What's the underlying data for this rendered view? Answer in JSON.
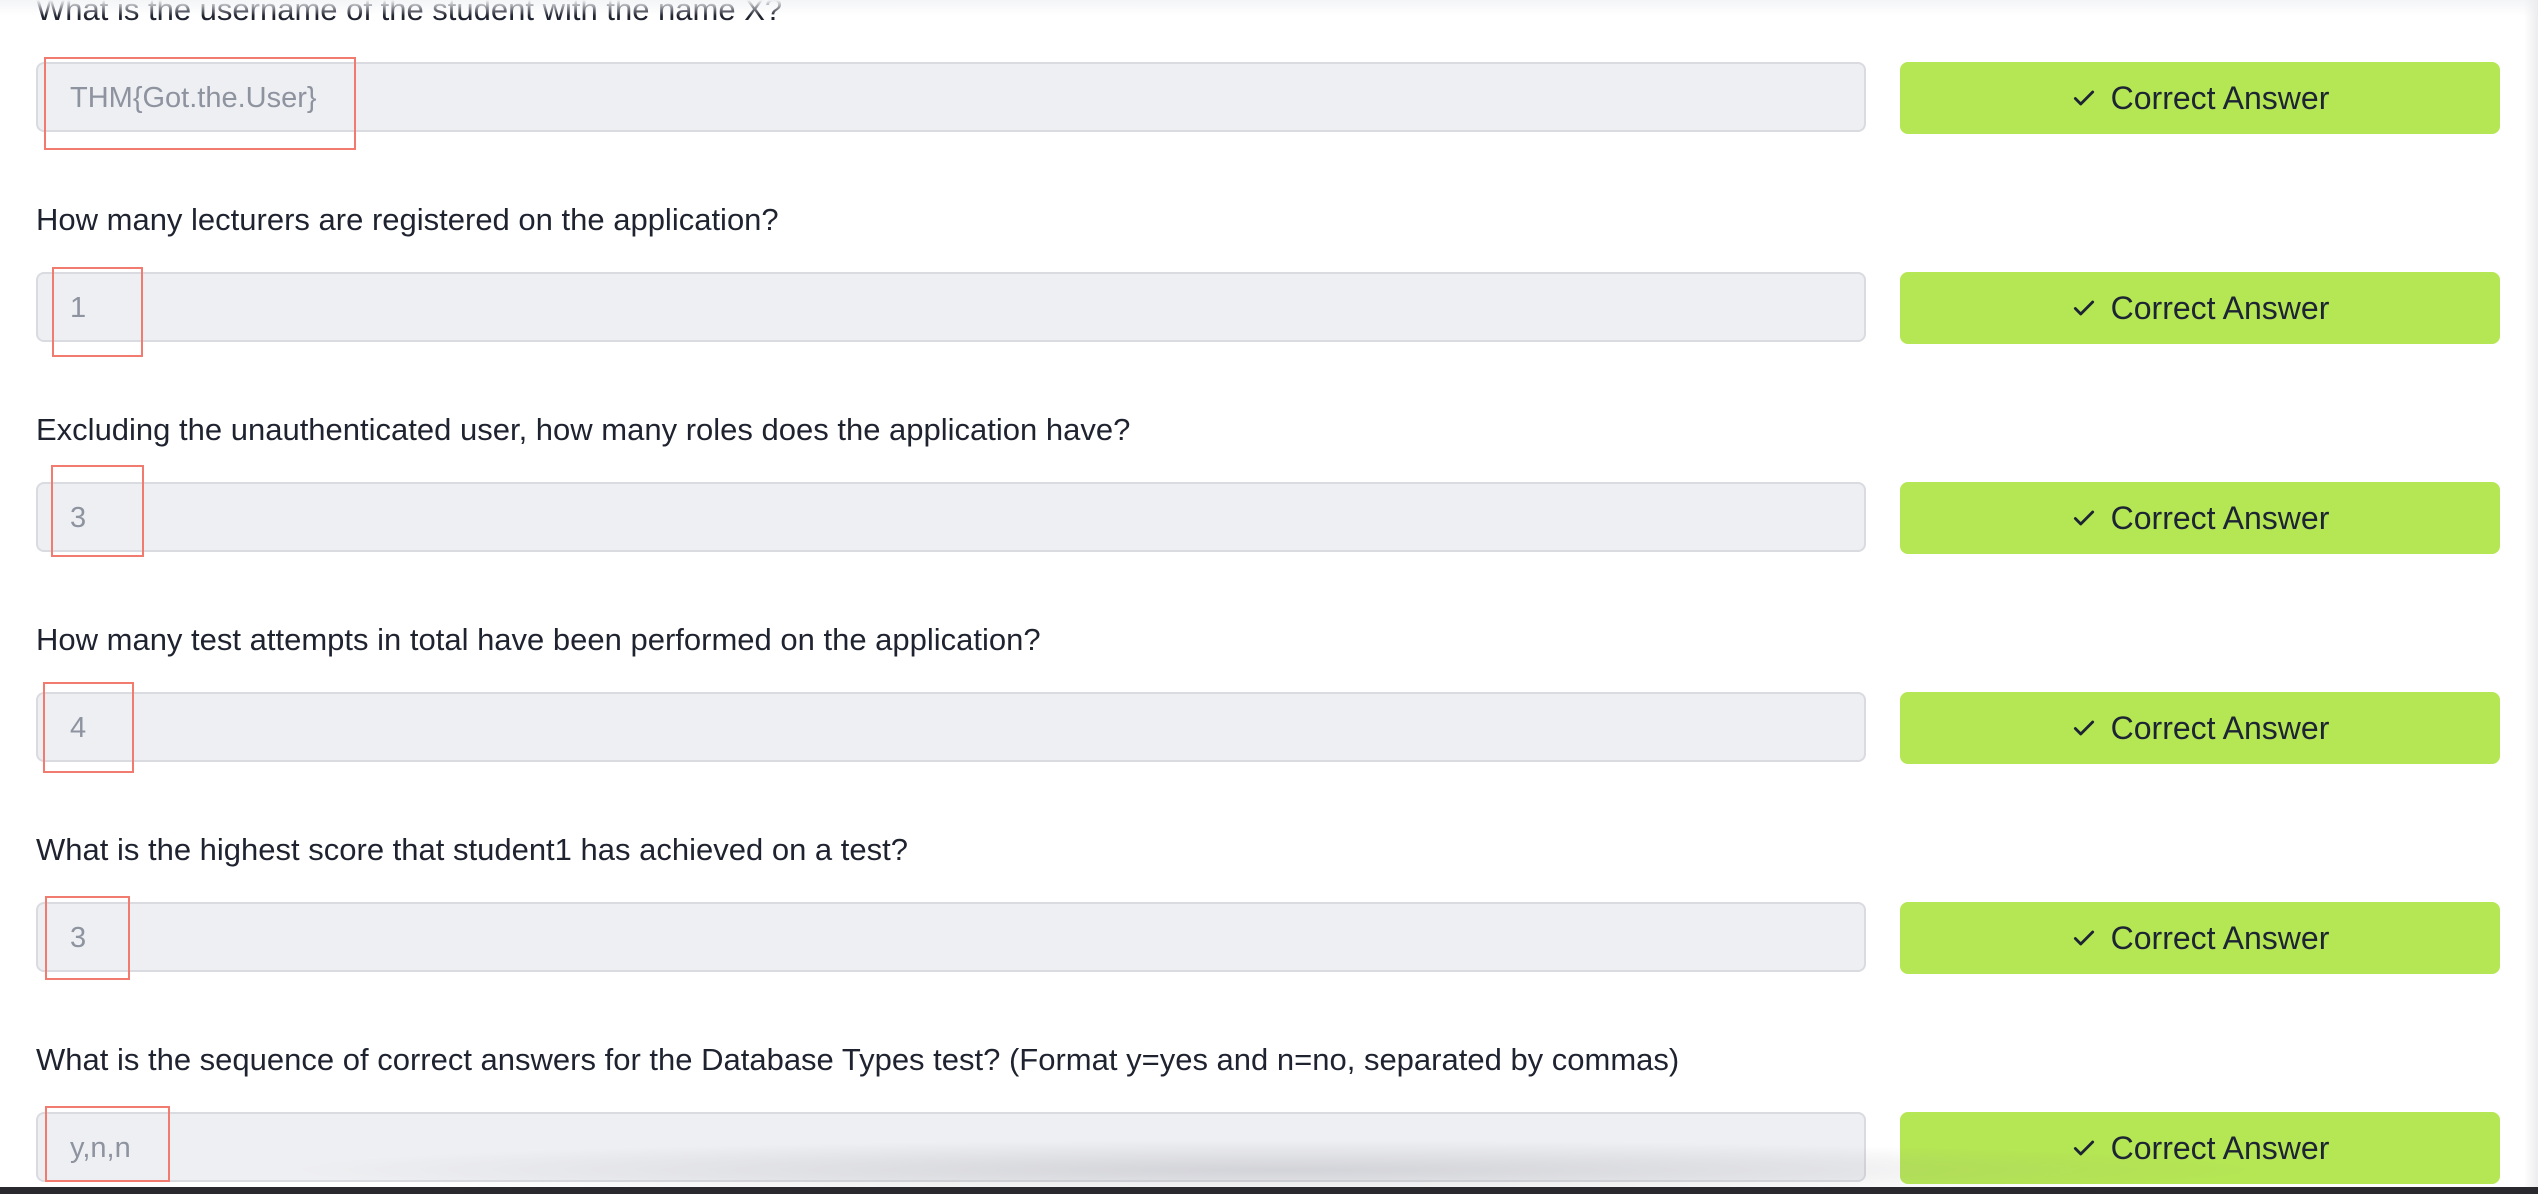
{
  "questions": [
    {
      "text": "What is the username of the student with the name X?",
      "answer": "THM{Got.the.User}",
      "button_label": "Correct Answer"
    },
    {
      "text": "How many lecturers are registered on the application?",
      "answer": "1",
      "button_label": "Correct Answer"
    },
    {
      "text": "Excluding the unauthenticated user, how many roles does the application have?",
      "answer": "3",
      "button_label": "Correct Answer"
    },
    {
      "text": "How many test attempts in total have been performed on the application?",
      "answer": "4",
      "button_label": "Correct Answer"
    },
    {
      "text": "What is the highest score that student1 has achieved on a test?",
      "answer": "3",
      "button_label": "Correct Answer"
    },
    {
      "text": "What is the sequence of correct answers for the Database Types test? (Format y=yes and n=no, separated by commas)",
      "answer": "y,n,n",
      "button_label": "Correct Answer"
    }
  ],
  "icons": {
    "button_icon": "check-icon"
  },
  "colors": {
    "button_bg": "#b5e653",
    "field_bg": "#eeeff2",
    "highlight": "#f07b6e",
    "answer_text": "#8e93a0",
    "question_text": "#1f2330"
  }
}
